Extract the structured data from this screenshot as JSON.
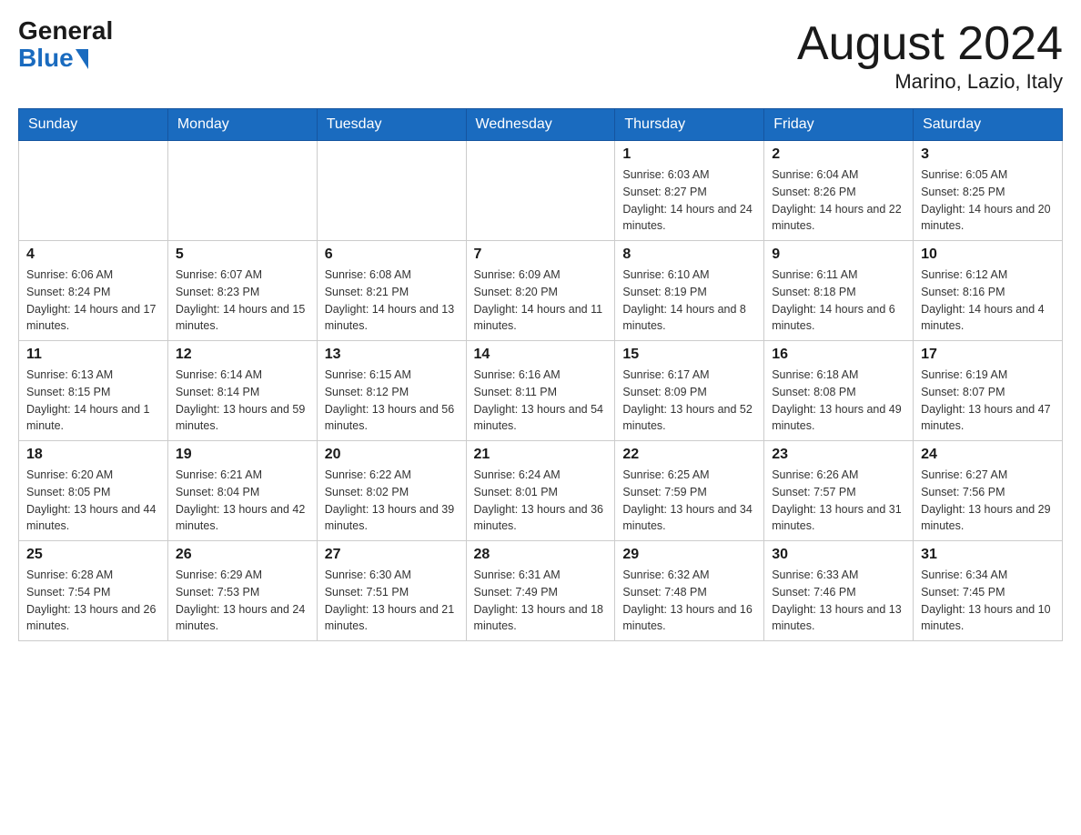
{
  "logo": {
    "general": "General",
    "blue": "Blue"
  },
  "header": {
    "month_year": "August 2024",
    "location": "Marino, Lazio, Italy"
  },
  "days_of_week": [
    "Sunday",
    "Monday",
    "Tuesday",
    "Wednesday",
    "Thursday",
    "Friday",
    "Saturday"
  ],
  "weeks": [
    [
      {
        "day": "",
        "info": ""
      },
      {
        "day": "",
        "info": ""
      },
      {
        "day": "",
        "info": ""
      },
      {
        "day": "",
        "info": ""
      },
      {
        "day": "1",
        "info": "Sunrise: 6:03 AM\nSunset: 8:27 PM\nDaylight: 14 hours and 24 minutes."
      },
      {
        "day": "2",
        "info": "Sunrise: 6:04 AM\nSunset: 8:26 PM\nDaylight: 14 hours and 22 minutes."
      },
      {
        "day": "3",
        "info": "Sunrise: 6:05 AM\nSunset: 8:25 PM\nDaylight: 14 hours and 20 minutes."
      }
    ],
    [
      {
        "day": "4",
        "info": "Sunrise: 6:06 AM\nSunset: 8:24 PM\nDaylight: 14 hours and 17 minutes."
      },
      {
        "day": "5",
        "info": "Sunrise: 6:07 AM\nSunset: 8:23 PM\nDaylight: 14 hours and 15 minutes."
      },
      {
        "day": "6",
        "info": "Sunrise: 6:08 AM\nSunset: 8:21 PM\nDaylight: 14 hours and 13 minutes."
      },
      {
        "day": "7",
        "info": "Sunrise: 6:09 AM\nSunset: 8:20 PM\nDaylight: 14 hours and 11 minutes."
      },
      {
        "day": "8",
        "info": "Sunrise: 6:10 AM\nSunset: 8:19 PM\nDaylight: 14 hours and 8 minutes."
      },
      {
        "day": "9",
        "info": "Sunrise: 6:11 AM\nSunset: 8:18 PM\nDaylight: 14 hours and 6 minutes."
      },
      {
        "day": "10",
        "info": "Sunrise: 6:12 AM\nSunset: 8:16 PM\nDaylight: 14 hours and 4 minutes."
      }
    ],
    [
      {
        "day": "11",
        "info": "Sunrise: 6:13 AM\nSunset: 8:15 PM\nDaylight: 14 hours and 1 minute."
      },
      {
        "day": "12",
        "info": "Sunrise: 6:14 AM\nSunset: 8:14 PM\nDaylight: 13 hours and 59 minutes."
      },
      {
        "day": "13",
        "info": "Sunrise: 6:15 AM\nSunset: 8:12 PM\nDaylight: 13 hours and 56 minutes."
      },
      {
        "day": "14",
        "info": "Sunrise: 6:16 AM\nSunset: 8:11 PM\nDaylight: 13 hours and 54 minutes."
      },
      {
        "day": "15",
        "info": "Sunrise: 6:17 AM\nSunset: 8:09 PM\nDaylight: 13 hours and 52 minutes."
      },
      {
        "day": "16",
        "info": "Sunrise: 6:18 AM\nSunset: 8:08 PM\nDaylight: 13 hours and 49 minutes."
      },
      {
        "day": "17",
        "info": "Sunrise: 6:19 AM\nSunset: 8:07 PM\nDaylight: 13 hours and 47 minutes."
      }
    ],
    [
      {
        "day": "18",
        "info": "Sunrise: 6:20 AM\nSunset: 8:05 PM\nDaylight: 13 hours and 44 minutes."
      },
      {
        "day": "19",
        "info": "Sunrise: 6:21 AM\nSunset: 8:04 PM\nDaylight: 13 hours and 42 minutes."
      },
      {
        "day": "20",
        "info": "Sunrise: 6:22 AM\nSunset: 8:02 PM\nDaylight: 13 hours and 39 minutes."
      },
      {
        "day": "21",
        "info": "Sunrise: 6:24 AM\nSunset: 8:01 PM\nDaylight: 13 hours and 36 minutes."
      },
      {
        "day": "22",
        "info": "Sunrise: 6:25 AM\nSunset: 7:59 PM\nDaylight: 13 hours and 34 minutes."
      },
      {
        "day": "23",
        "info": "Sunrise: 6:26 AM\nSunset: 7:57 PM\nDaylight: 13 hours and 31 minutes."
      },
      {
        "day": "24",
        "info": "Sunrise: 6:27 AM\nSunset: 7:56 PM\nDaylight: 13 hours and 29 minutes."
      }
    ],
    [
      {
        "day": "25",
        "info": "Sunrise: 6:28 AM\nSunset: 7:54 PM\nDaylight: 13 hours and 26 minutes."
      },
      {
        "day": "26",
        "info": "Sunrise: 6:29 AM\nSunset: 7:53 PM\nDaylight: 13 hours and 24 minutes."
      },
      {
        "day": "27",
        "info": "Sunrise: 6:30 AM\nSunset: 7:51 PM\nDaylight: 13 hours and 21 minutes."
      },
      {
        "day": "28",
        "info": "Sunrise: 6:31 AM\nSunset: 7:49 PM\nDaylight: 13 hours and 18 minutes."
      },
      {
        "day": "29",
        "info": "Sunrise: 6:32 AM\nSunset: 7:48 PM\nDaylight: 13 hours and 16 minutes."
      },
      {
        "day": "30",
        "info": "Sunrise: 6:33 AM\nSunset: 7:46 PM\nDaylight: 13 hours and 13 minutes."
      },
      {
        "day": "31",
        "info": "Sunrise: 6:34 AM\nSunset: 7:45 PM\nDaylight: 13 hours and 10 minutes."
      }
    ]
  ]
}
